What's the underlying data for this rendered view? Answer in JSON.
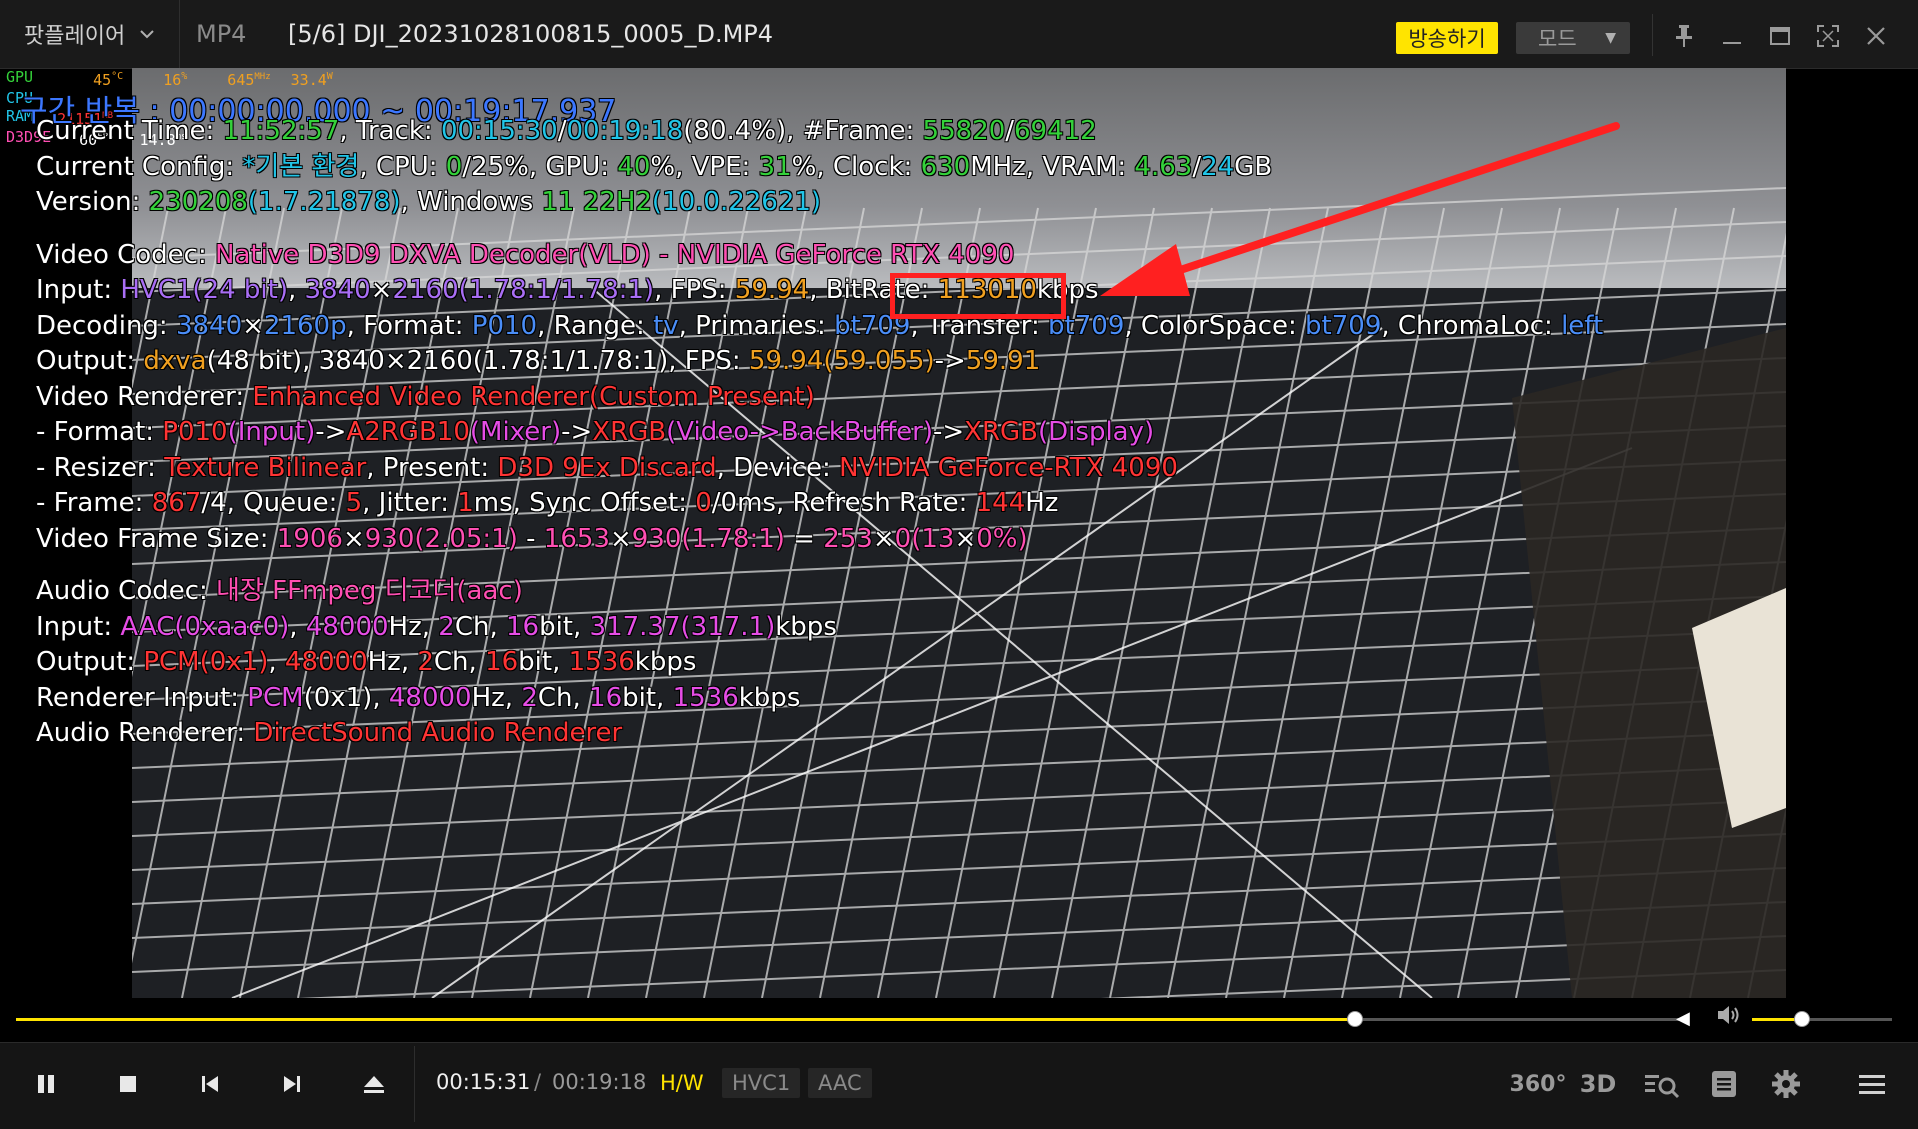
{
  "titlebar": {
    "app_name": "팟플레이어",
    "format": "MP4",
    "file_title": "[5/6]  DJI_20231028100815_0005_D.MP4",
    "broadcast_label": "방송하기",
    "mode_label": "모드"
  },
  "osd": {
    "gpu_label": "GPU",
    "gpu_temp": "45",
    "gpu_temp_unit": "°C",
    "gpu_load": "16",
    "gpu_load_unit": "%",
    "gpu_clock": "645",
    "gpu_clock_unit": "MHz",
    "gpu_power": "33.4",
    "gpu_power_unit": "W",
    "cpu_label": "CPU",
    "ram_label": "RAM",
    "ram_value": "21151",
    "ram_unit": "MB",
    "d3d_label": "D3D9E",
    "fps": "60",
    "fps_unit": "FPS",
    "frametime": "14.8",
    "frametime_unit": "ms"
  },
  "repeat_banner": "구간 반복 : 00:00:00.000 ~ 00:19:17.937",
  "info": {
    "l1": {
      "label": "Current Time: ",
      "time": "11:52:57",
      "track_label": ", Track: ",
      "track_cur": "00:15:30",
      "slash": "/",
      "track_total": "00:19:18",
      "pct": "(80.4%)",
      "frame_label": ", #Frame: ",
      "frame_cur": "55820",
      "frame_slash": "/",
      "frame_total": "69412"
    },
    "l2": {
      "label": "Current Config: ",
      "config": "*기본 환경",
      "cpu_label": ", CPU: ",
      "cpu_a": "0",
      "cpu_b": "/25%",
      "gpu_label": ", GPU: ",
      "gpu": "40",
      "gpu_pct": "%",
      "vpe_label": ", VPE: ",
      "vpe": "31",
      "vpe_pct": "%",
      "clock_label": ", Clock: ",
      "clock": "630",
      "clock_unit": "MHz",
      "vram_label": ", VRAM: ",
      "vram_used": "4.63",
      "vram_slash": "/",
      "vram_total": "24",
      "vram_unit": "GB"
    },
    "l3": {
      "label": "Version: ",
      "build": "230208",
      "ver": "(1.7.21878)",
      "os_label": ", Windows ",
      "os_ver": "11 22H2",
      "os_build": "(10.0.22621)"
    },
    "v1": {
      "label": "Video Codec: ",
      "value": "Native D3D9 DXVA Decoder(VLD) - NVIDIA GeForce RTX 4090"
    },
    "v2": {
      "label": "Input: ",
      "codec": "HVC1",
      "bits": "(24 bit)",
      "sep": ", ",
      "w": "3840",
      "x": "×",
      "h": "2160",
      "ar": "(1.78:1/1.78:1)",
      "fps_label": ", FPS: ",
      "fps": "59.94",
      "br_label": ", BitRate: ",
      "br": "113010",
      "br_unit": "kbps"
    },
    "v3": {
      "label": "Decoding: ",
      "w": "3840",
      "x": "×",
      "h": "2160p",
      "fmt_label": ", Format: ",
      "fmt": "P010",
      "range_label": ", Range: ",
      "range": "tv",
      "prim_label": ", Primaries: ",
      "prim": "bt709",
      "trans_label": ", Transfer: ",
      "trans": "bt709",
      "cs_label": ", ColorSpace: ",
      "cs": "bt709",
      "cl_label": ", ChromaLoc: ",
      "cl": "left"
    },
    "v4": {
      "label": "Output: ",
      "api": "dxva",
      "bits": "(48 bit)",
      "res": ", 3840×2160(1.78:1/1.78:1)",
      "fps_label": ", FPS: ",
      "fps": "59.94",
      "fps2": "(59.055)",
      "arrow": "->",
      "fps3": "59.91"
    },
    "v5": {
      "label": "Video Renderer: ",
      "value": "Enhanced Video Renderer(Custom Present)"
    },
    "v6": {
      "label": " - Format: ",
      "f1": "P010",
      "t1": "(Input)",
      "a1": "->",
      "f2": "A2RGB10",
      "t2": "(Mixer)",
      "a2": "->",
      "f3": "XRGB",
      "t3": "(Video->BackBuffer)",
      "a3": "->",
      "f4": "XRGB",
      "t4": "(Display)"
    },
    "v7": {
      "label": " - Resizer: ",
      "resizer": "Texture Bilinear",
      "present_label": ", Present: ",
      "present": "D3D 9Ex Discard",
      "device_label": ", Device: ",
      "device": "NVIDIA GeForce-RTX 4090"
    },
    "v8": {
      "label": " - Frame: ",
      "frame": "867",
      "frame_b": "/4",
      "queue_label": ", Queue: ",
      "queue": "5",
      "jitter_label": ", Jitter: ",
      "jitter": "1",
      "jitter_unit": "ms",
      "sync_label": ", Sync Offset: ",
      "sync": "0",
      "sync_b": "/0ms",
      "rr_label": ", Refresh Rate: ",
      "rr": "144",
      "rr_unit": "Hz"
    },
    "v9": {
      "label": "Video Frame Size: ",
      "a_w": "1906",
      "x1": "×",
      "a_h": "930",
      "a_ar": "(2.05:1)",
      "minus": " - ",
      "b_w": "1653",
      "x2": "×",
      "b_h": "930",
      "b_ar": "(1.78:1)",
      "eq": " = ",
      "c_w": "253",
      "x3": "×",
      "c_h": "0",
      "c_p": "(13",
      "x4": "×",
      "c_q": "0%)"
    },
    "a1": {
      "label": "Audio Codec: ",
      "value": "내장 FFmpeg 디코더(aac)"
    },
    "a2": {
      "label": "Input: ",
      "codec": "AAC",
      "hex": "(0xaac0)",
      "sep": ", ",
      "hz": "48000",
      "hz_unit": "Hz, ",
      "ch": "2",
      "ch_unit": "Ch, ",
      "bit": "16",
      "bit_unit": "bit, ",
      "kb": "317.37",
      "kb2": "(317.1)",
      "kb_unit": "kbps"
    },
    "a3": {
      "label": "Output: ",
      "codec": "PCM",
      "hex": "(0x1)",
      "sep": ", ",
      "hz": "48000",
      "hz_unit": "Hz, ",
      "ch": "2",
      "ch_unit": "Ch, ",
      "bit": "16",
      "bit_unit": "bit, ",
      "kb": "1536",
      "kb_unit": "kbps"
    },
    "a4": {
      "label": "Renderer Input: ",
      "codec": "PCM",
      "hex": "(0x1)",
      "sep": ", ",
      "hz": "48000",
      "hz_unit": "Hz, ",
      "ch": "2",
      "ch_unit": "Ch, ",
      "bit": "16",
      "bit_unit": "bit, ",
      "kb": "1536",
      "kb_unit": "kbps"
    },
    "a5": {
      "label": "Audio Renderer: ",
      "value": "DirectSound Audio Renderer"
    }
  },
  "playback": {
    "progress": 0.804,
    "volume": 0.36,
    "current_time": "00:15:31",
    "separator": "/",
    "total_time": "00:19:18",
    "tags": {
      "hw": "H/W",
      "video": "HVC1",
      "audio": "AAC"
    },
    "icon_360": "360°",
    "icon_3d": "3D"
  },
  "colors": {
    "accent": "#ffe400",
    "highlight": "#ff2020"
  }
}
